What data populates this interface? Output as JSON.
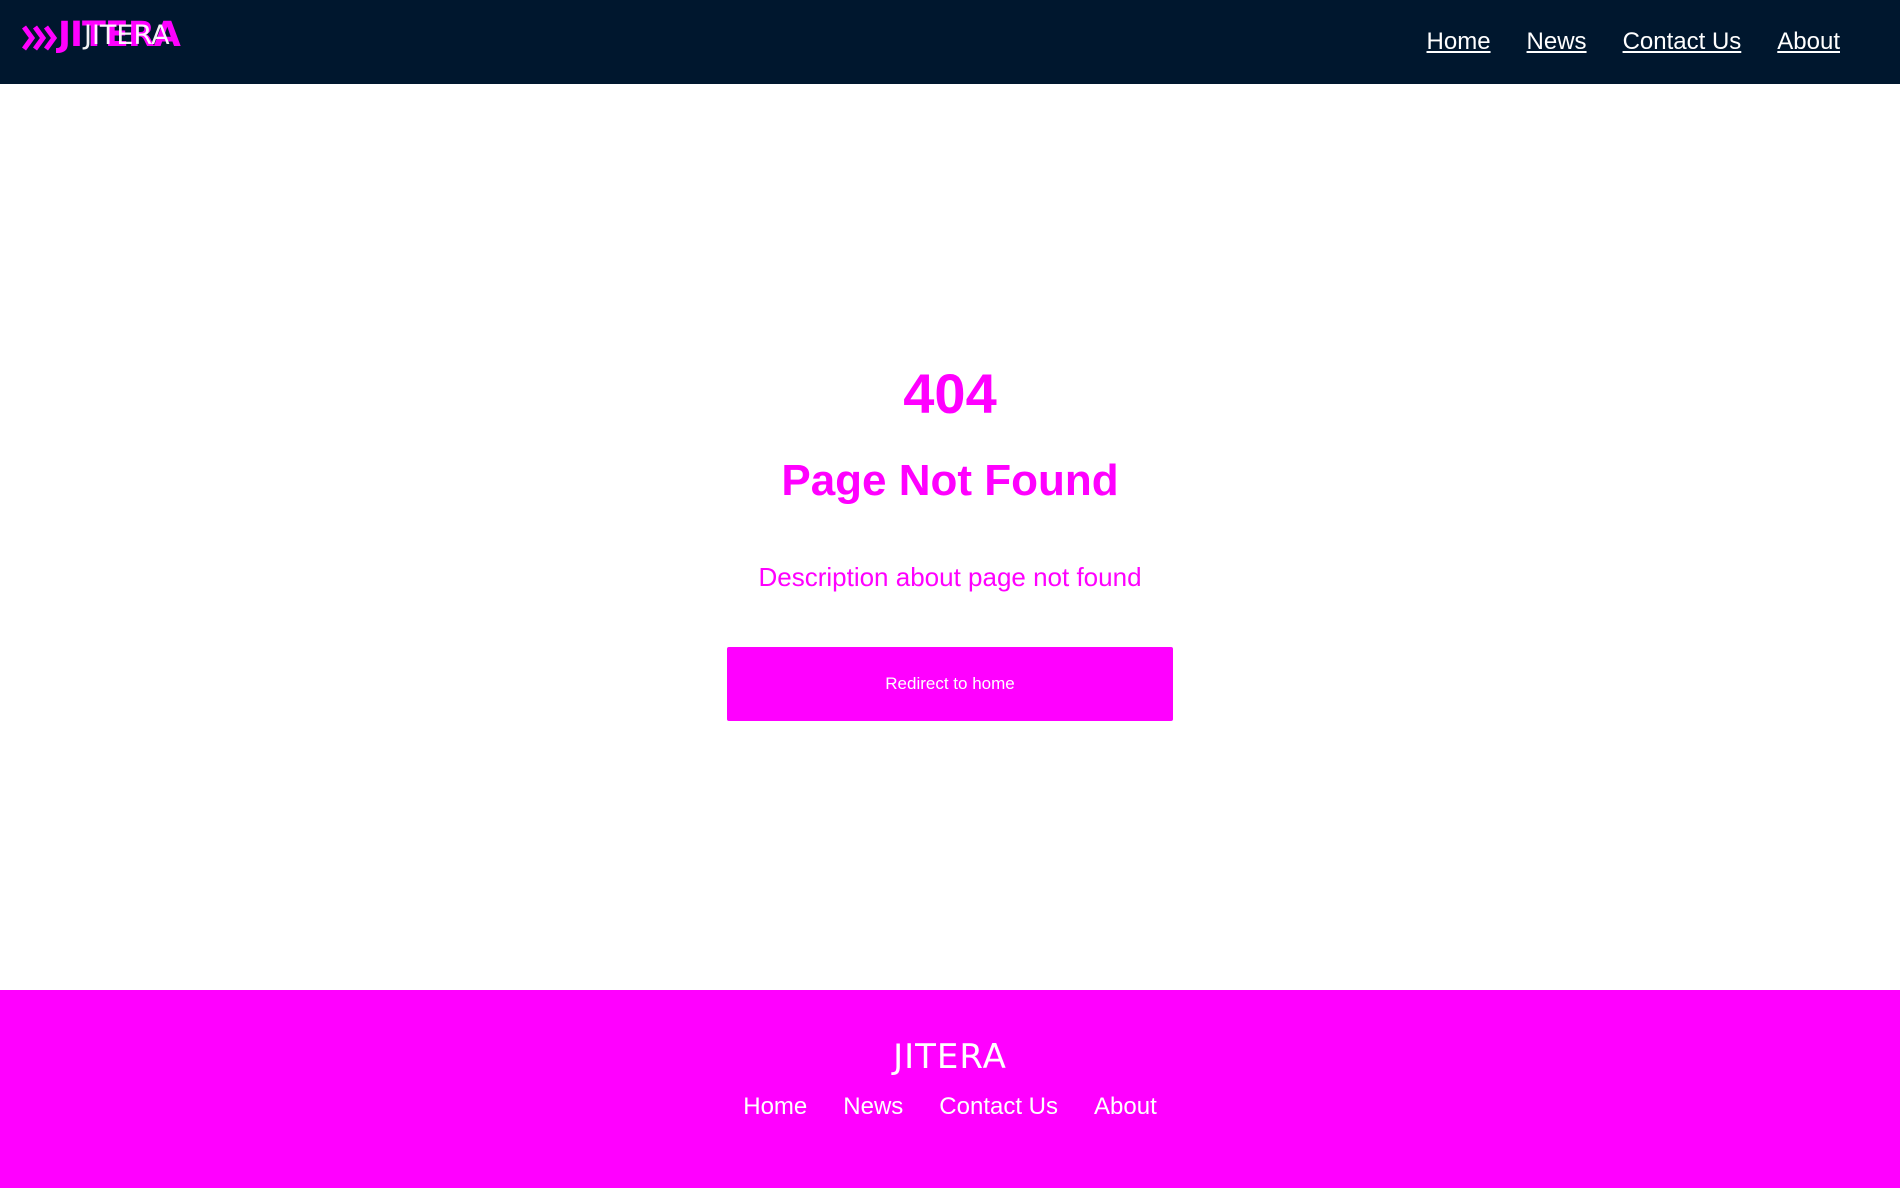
{
  "header": {
    "logo_text": "JITERA",
    "nav": [
      {
        "label": "Home"
      },
      {
        "label": "News"
      },
      {
        "label": "Contact Us"
      },
      {
        "label": "About"
      }
    ]
  },
  "main": {
    "code": "404",
    "title": "Page Not Found",
    "description": "Description about page not found",
    "button_label": "Redirect to home"
  },
  "footer": {
    "logo_text": "JITERA",
    "nav": [
      {
        "label": "Home"
      },
      {
        "label": "News"
      },
      {
        "label": "Contact Us"
      },
      {
        "label": "About"
      }
    ]
  },
  "colors": {
    "header_bg": "#00172e",
    "accent": "#ff00ff",
    "text_light": "#ffffff"
  },
  "icons": {
    "logo_mark": "chevrons-right-icon"
  }
}
